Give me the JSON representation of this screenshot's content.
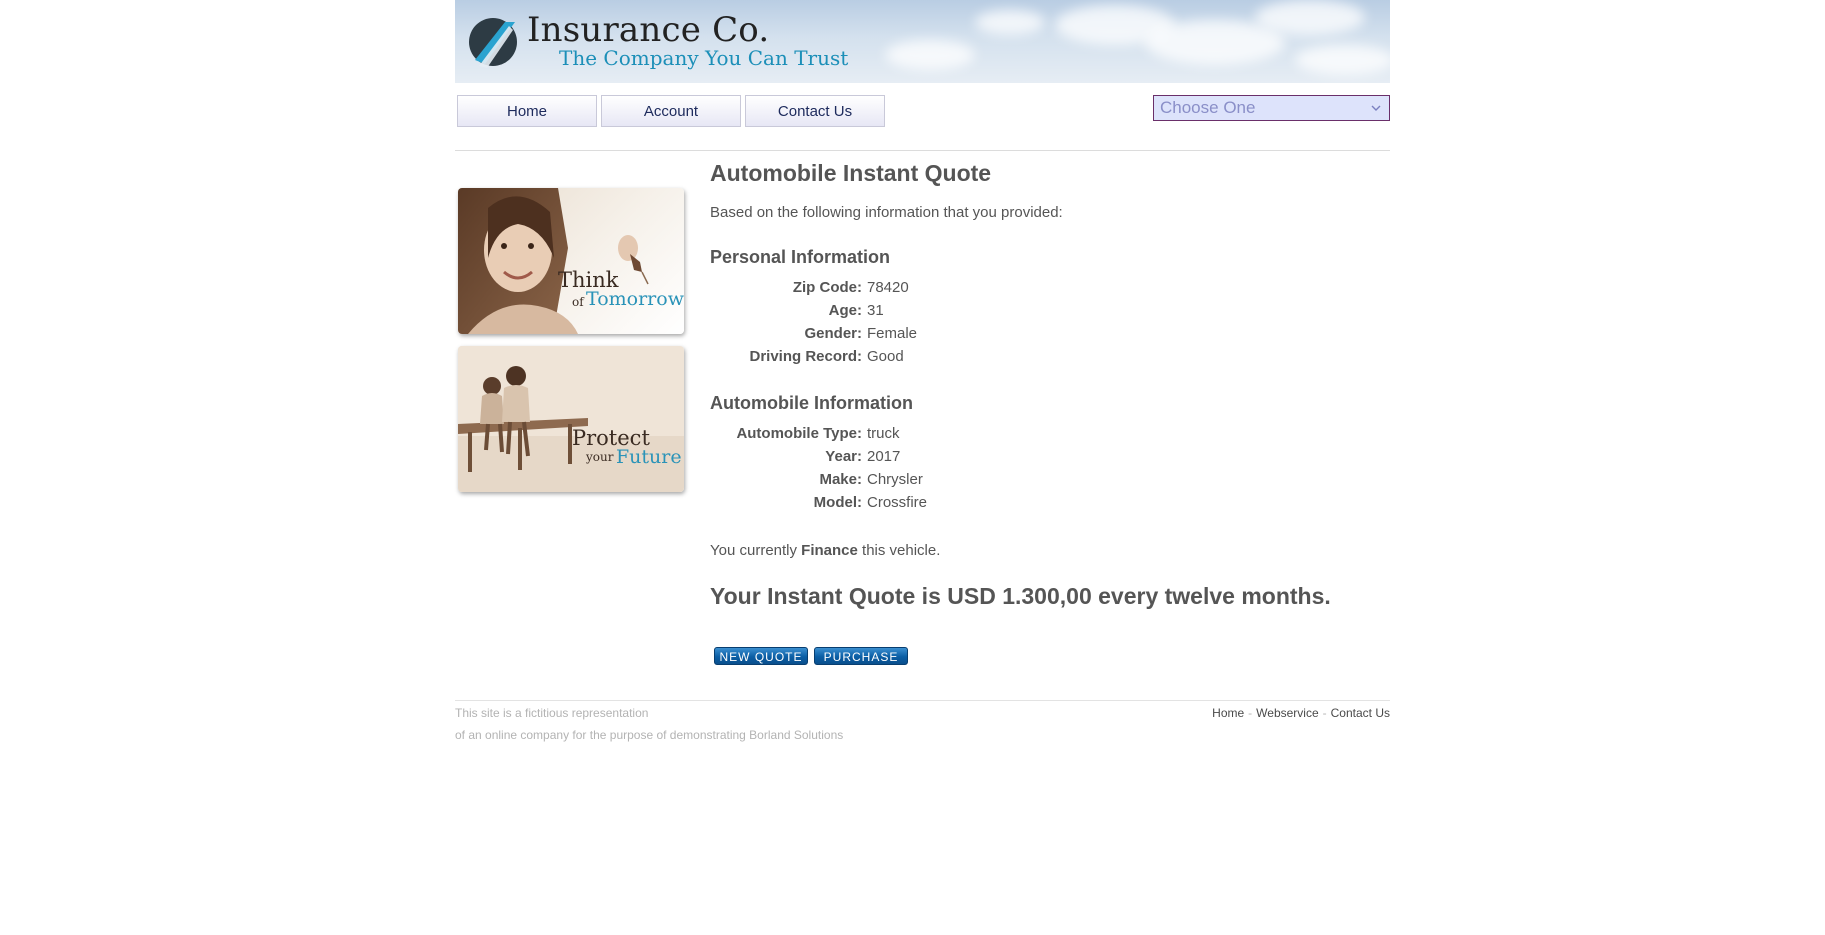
{
  "header": {
    "brand_name": "Insurance Co.",
    "tagline": "The Company You Can Trust"
  },
  "nav": {
    "items": [
      {
        "label": "Home"
      },
      {
        "label": "Account"
      },
      {
        "label": "Contact Us"
      }
    ],
    "select": {
      "value": "Choose One",
      "icon": "chevron-down-icon"
    }
  },
  "promos": [
    {
      "line1": "Think",
      "small": "of",
      "accent": "Tomorrow"
    },
    {
      "line1": "Protect",
      "small": "your",
      "accent": "Future"
    }
  ],
  "main": {
    "title": "Automobile Instant Quote",
    "intro": "Based on the following information that you provided:",
    "personal": {
      "heading": "Personal Information",
      "rows": [
        {
          "label": "Zip Code:",
          "value": "78420"
        },
        {
          "label": "Age:",
          "value": "31"
        },
        {
          "label": "Gender:",
          "value": "Female"
        },
        {
          "label": "Driving Record:",
          "value": "Good"
        }
      ]
    },
    "automobile": {
      "heading": "Automobile Information",
      "rows": [
        {
          "label": "Automobile Type:",
          "value": "truck"
        },
        {
          "label": "Year:",
          "value": "2017"
        },
        {
          "label": "Make:",
          "value": "Chrysler"
        },
        {
          "label": "Model:",
          "value": "Crossfire"
        }
      ]
    },
    "finance": {
      "prefix": "You currently",
      "status": "Finance",
      "suffix": "this vehicle."
    },
    "quote": "Your Instant Quote is USD 1.300,00 every twelve months.",
    "buttons": {
      "new_quote": "NEW QUOTE",
      "purchase": "PURCHASE"
    }
  },
  "footer": {
    "note_line1": "This site is a fictitious representation",
    "note_line2": "of an online company for the purpose of demonstrating Borland Solutions",
    "links": [
      {
        "label": "Home"
      },
      {
        "label": "Webservice"
      },
      {
        "label": "Contact Us"
      }
    ],
    "separator": "-"
  },
  "colors": {
    "accent_blue": "#1c8fb8",
    "button_blue": "#0b5ea5",
    "nav_text": "#1d2a5c",
    "select_border": "#6a2f6a"
  }
}
